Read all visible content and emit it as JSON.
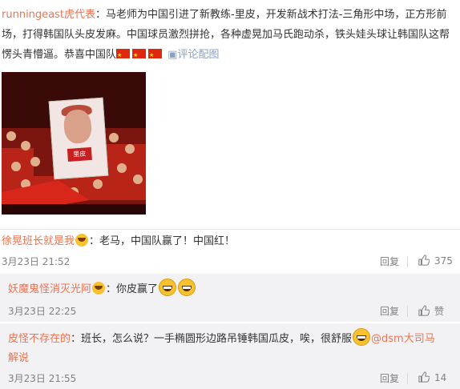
{
  "post": {
    "user": "runningeast虎代表",
    "text": "：马老师为中国引进了新教练-里皮，开发新战术打法-三角形中场，正方形前场，打得韩国队头皮发麻。中国球员激烈拼抢，各种虚晃加马氏跑动杀，铁头娃头球让韩国队这帮愣头青懵逼。恭喜中国队",
    "link": "评论配图",
    "banner_text": "里皮",
    "flag_icons": [
      "china-flag",
      "china-flag",
      "china-flag"
    ]
  },
  "comments": [
    {
      "user": "徐晃班长就是我",
      "text": "：老马，中国队赢了！中国红！",
      "time": "3月23日 21:52",
      "reply": "回复",
      "likes": "375"
    },
    {
      "user": "妖魔鬼怪消灭光阿",
      "text": "：你皮赢了",
      "time": "3月23日 22:25",
      "reply": "回复",
      "likes": "赞"
    },
    {
      "user": "皮怪不存在的",
      "text": "：班长，怎么说？一手椭圆形边路吊锤韩国瓜皮，唉，很舒服",
      "mention": "@dsm大司马",
      "mention_tail": "解说",
      "time": "3月23日 21:55",
      "reply": "回复",
      "likes": "14"
    }
  ],
  "colors": {
    "username": "#eb7350",
    "link": "#8aa0c0",
    "meta": "#808080",
    "reply_bg": "#f2f2f5"
  }
}
